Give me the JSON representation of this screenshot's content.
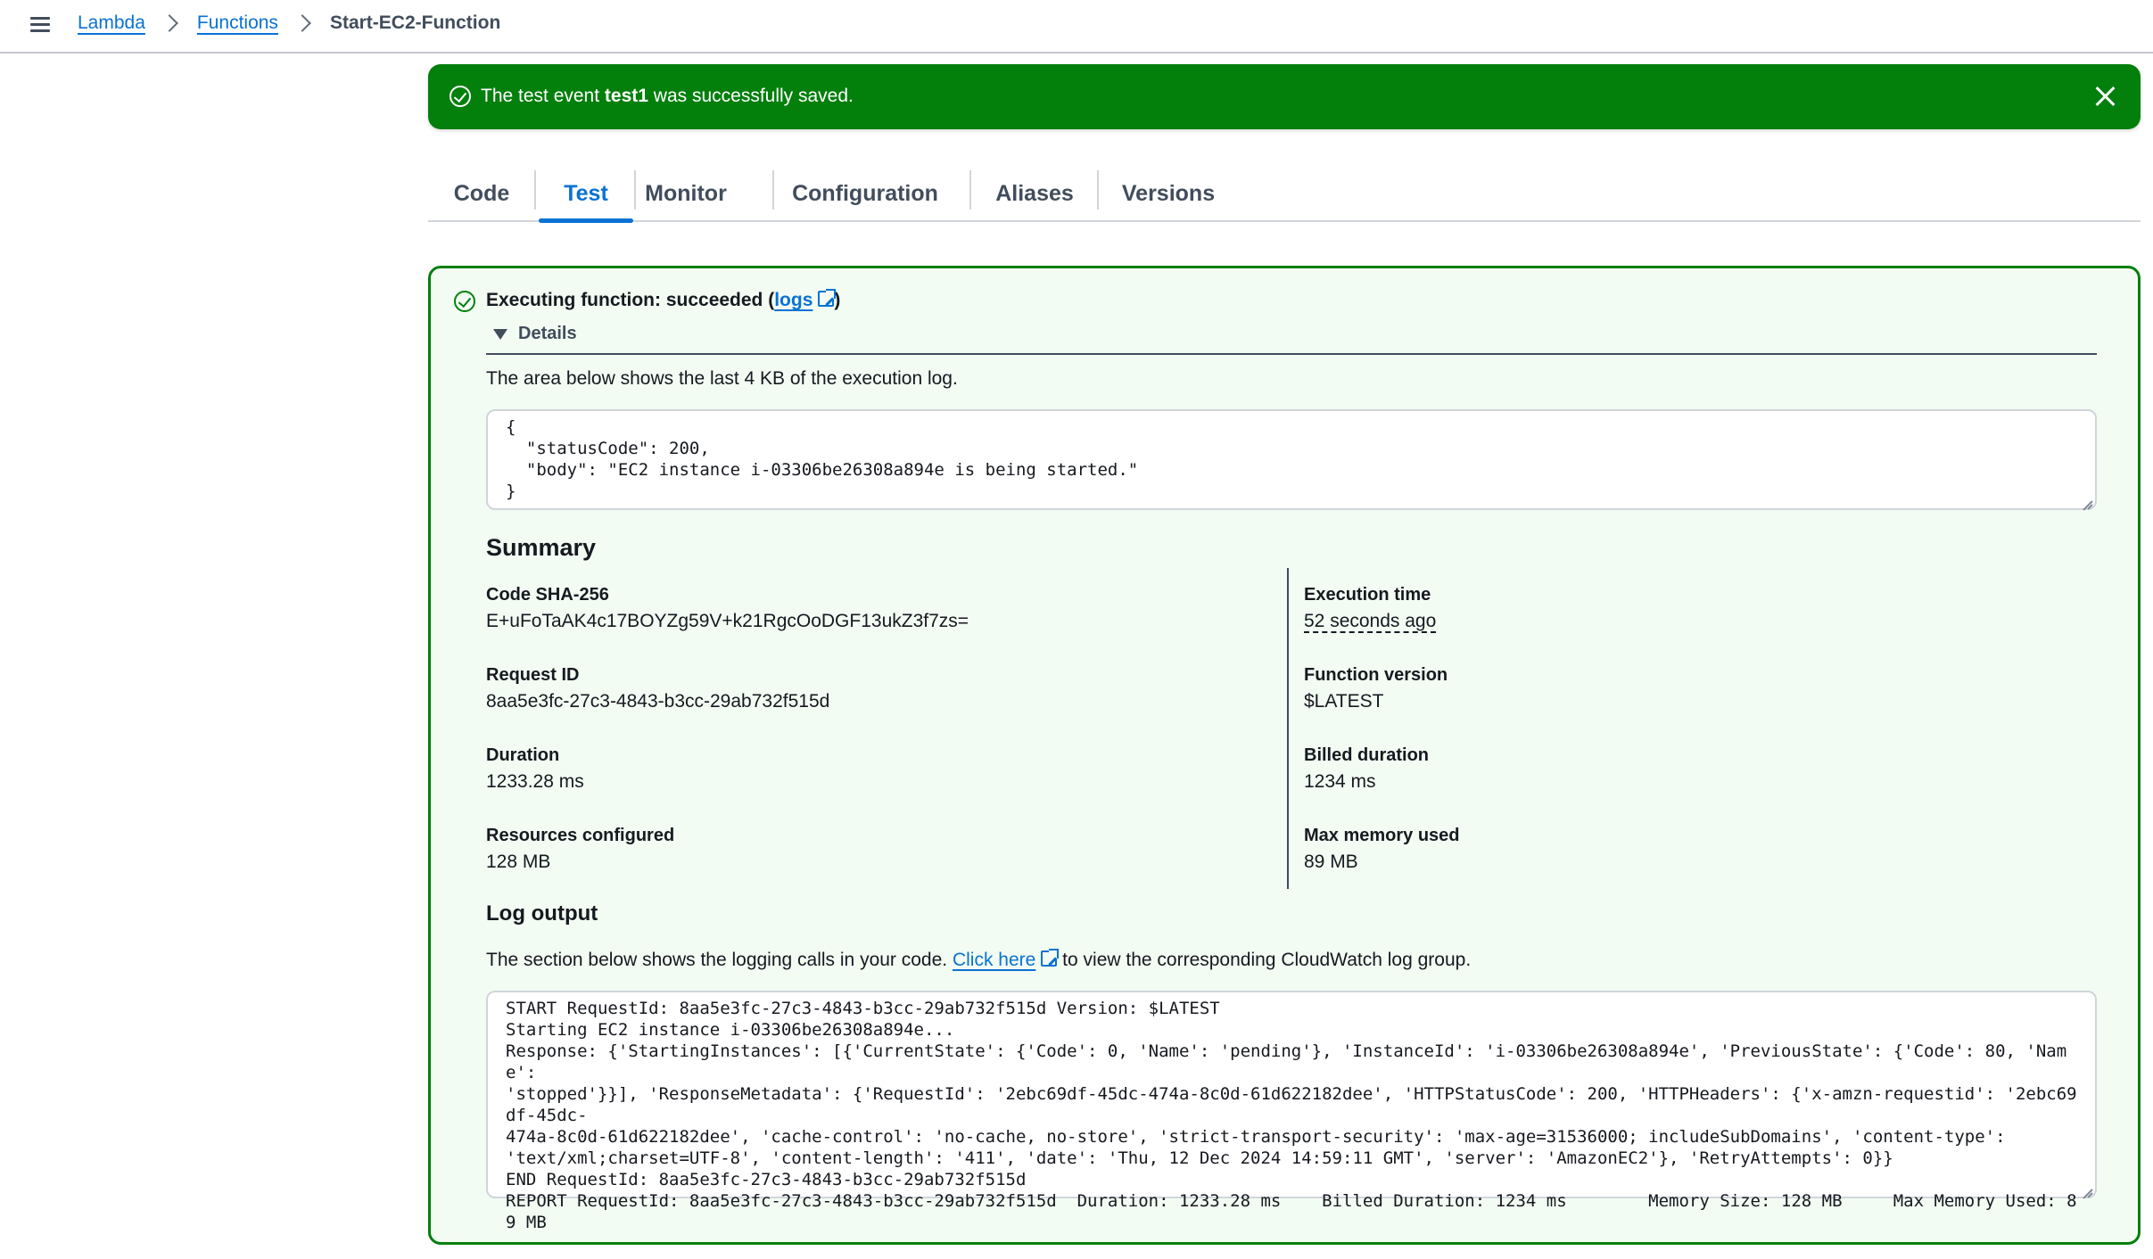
{
  "breadcrumb": {
    "items": [
      "Lambda",
      "Functions"
    ],
    "current": "Start-EC2-Function"
  },
  "flash": {
    "prefix": "The test event ",
    "event_name": "test1",
    "suffix": " was successfully saved.",
    "color": "#037f0c"
  },
  "tabs": [
    {
      "label": "Code",
      "active": false
    },
    {
      "label": "Test",
      "active": true
    },
    {
      "label": "Monitor",
      "active": false
    },
    {
      "label": "Configuration",
      "active": false
    },
    {
      "label": "Aliases",
      "active": false
    },
    {
      "label": "Versions",
      "active": false
    }
  ],
  "result": {
    "title_prefix": "Executing function: succeeded (",
    "logs_label": "logs",
    "title_suffix": ")",
    "details_label": "Details",
    "description": "The area below shows the last 4 KB of the execution log.",
    "output_lines": [
      "{",
      "  \"statusCode\": 200,",
      "  \"body\": \"EC2 instance i-03306be26308a894e is being started.\"",
      "}"
    ]
  },
  "summary": {
    "heading": "Summary",
    "left": [
      {
        "label": "Code SHA-256",
        "value": "E+uFoTaAK4c17BOYZg59V+k21RgcOoDGF13ukZ3f7zs="
      },
      {
        "label": "Request ID",
        "value": "8aa5e3fc-27c3-4843-b3cc-29ab732f515d"
      },
      {
        "label": "Duration",
        "value": "1233.28 ms"
      },
      {
        "label": "Resources configured",
        "value": "128 MB"
      }
    ],
    "right": [
      {
        "label": "Execution time",
        "value": "52 seconds ago"
      },
      {
        "label": "Function version",
        "value": "$LATEST"
      },
      {
        "label": "Billed duration",
        "value": "1234 ms"
      },
      {
        "label": "Max memory used",
        "value": "89 MB"
      }
    ]
  },
  "log_output": {
    "heading": "Log output",
    "desc_prefix": "The section below shows the logging calls in your code. ",
    "link_label": "Click here",
    "desc_suffix": " to view the corresponding CloudWatch log group.",
    "lines": [
      "START RequestId: 8aa5e3fc-27c3-4843-b3cc-29ab732f515d Version: $LATEST",
      "Starting EC2 instance i-03306be26308a894e...",
      "Response: {'StartingInstances': [{'CurrentState': {'Code': 0, 'Name': 'pending'}, 'InstanceId': 'i-03306be26308a894e', 'PreviousState': {'Code': 80, 'Name':",
      "'stopped'}}], 'ResponseMetadata': {'RequestId': '2ebc69df-45dc-474a-8c0d-61d622182dee', 'HTTPStatusCode': 200, 'HTTPHeaders': {'x-amzn-requestid': '2ebc69df-45dc-",
      "474a-8c0d-61d622182dee', 'cache-control': 'no-cache, no-store', 'strict-transport-security': 'max-age=31536000; includeSubDomains', 'content-type':",
      "'text/xml;charset=UTF-8', 'content-length': '411', 'date': 'Thu, 12 Dec 2024 14:59:11 GMT', 'server': 'AmazonEC2'}, 'RetryAttempts': 0}}",
      "END RequestId: 8aa5e3fc-27c3-4843-b3cc-29ab732f515d",
      "REPORT RequestId: 8aa5e3fc-27c3-4843-b3cc-29ab732f515d\tDuration: 1233.28 ms\tBilled Duration: 1234 ms\tMemory Size: 128 MB\tMax Memory Used: 89 MB"
    ]
  }
}
